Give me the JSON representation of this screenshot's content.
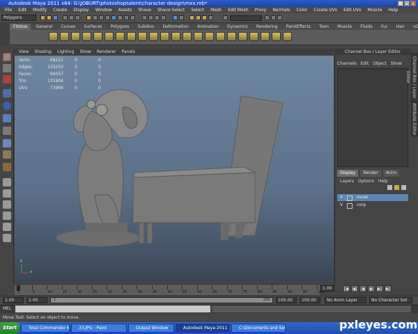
{
  "window": {
    "title": "Autodesk Maya 2011 x64: G:\\JOBURT\\photoshoptalent\\character design\\mxx.mb*"
  },
  "window_controls": {
    "minimize": "_",
    "maximize": "□",
    "close": "x"
  },
  "menubar": [
    "File",
    "Edit",
    "Modify",
    "Create",
    "Display",
    "Window",
    "Assets",
    "Shave",
    "Shave Select",
    "Select",
    "Mesh",
    "Edit Mesh",
    "Proxy",
    "Normals",
    "Color",
    "Create UVs",
    "Edit UVs",
    "Muscle",
    "Help"
  ],
  "statusline": {
    "mode": "Polygons"
  },
  "shelf": {
    "tabs": [
      "FXmus",
      "General",
      "Curves",
      "Surfaces",
      "Polygons",
      "Subdivs",
      "Deformation",
      "Animation",
      "Dynamics",
      "Rendering",
      "PaintEffects",
      "Toon",
      "Muscle",
      "Fluids",
      "Fur",
      "Hair",
      "nCloth",
      "advancedSkeleton"
    ],
    "active_tab": "FXmus"
  },
  "viewport": {
    "menu": [
      "View",
      "Shading",
      "Lighting",
      "Show",
      "Renderer",
      "Panels"
    ],
    "hud": [
      {
        "label": "Verts:",
        "v1": "68221",
        "v2": "0",
        "v3": "0"
      },
      {
        "label": "Edges:",
        "v1": "133250",
        "v2": "0",
        "v3": "0"
      },
      {
        "label": "Faces:",
        "v1": "66057",
        "v2": "0",
        "v3": "0"
      },
      {
        "label": "Tris:",
        "v1": "131904",
        "v2": "0",
        "v3": "0"
      },
      {
        "label": "UVs:",
        "v1": "73966",
        "v2": "0",
        "v3": "0"
      }
    ],
    "axis": {
      "y": "y",
      "x": "x"
    }
  },
  "channel_box": {
    "title": "Channel Box / Layer Editor",
    "menu": [
      "Channels",
      "Edit",
      "Object",
      "Show"
    ]
  },
  "layer_editor": {
    "tabs": [
      "Display",
      "Render",
      "Anim"
    ],
    "active_tab": "Display",
    "menu": [
      "Layers",
      "Options",
      "Help"
    ],
    "layers": [
      {
        "visible": "V",
        "name": "mcao",
        "selected": true
      },
      {
        "visible": "V",
        "name": "corp",
        "selected": false
      }
    ]
  },
  "side_tabs": [
    "Channel Box / Layer Editor",
    "Attribute Editor"
  ],
  "timeslider": {
    "ticks": [
      "1",
      "5",
      "10",
      "15",
      "20",
      "25",
      "30",
      "35",
      "40",
      "45",
      "50",
      "55",
      "60",
      "65",
      "70",
      "75",
      "80",
      "85",
      "90",
      "95",
      "100"
    ],
    "current_frame": "1.00"
  },
  "playback": {
    "buttons": [
      "|◀",
      "◀|",
      "◀",
      "▶",
      "▶|",
      "▶|"
    ]
  },
  "range": {
    "start": "1.00",
    "current": "1.00",
    "range_start_label": "1",
    "range_end_label": "100",
    "end": "100.00",
    "anim_end": "100.00",
    "anim_layer": "No Anim Layer",
    "character_set": "No Character Set"
  },
  "command_line": {
    "label": "MEL"
  },
  "help_line": {
    "text": "Move Tool: Select an object to move."
  },
  "taskbar": {
    "start": "Start",
    "items": [
      {
        "label": "Total Commander 6.03 - ...",
        "active": false
      },
      {
        "label": "33.JPG - Paint",
        "active": false
      },
      {
        "label": "Output Window",
        "active": false
      },
      {
        "label": "Autodesk Maya 2011 ...",
        "active": true
      },
      {
        "label": "C:\\Documents and Settin...",
        "active": false
      }
    ]
  },
  "watermark": "pxleyes.com",
  "colors": {
    "viewport_top": "#6e87a0",
    "viewport_bottom": "#3a4656",
    "selection": "#5b86b2",
    "taskbar": "#3169c6"
  }
}
